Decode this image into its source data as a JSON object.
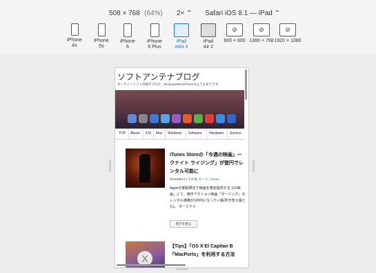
{
  "toolbar": {
    "size": "508 × 768",
    "zoom": "(64%)",
    "scale": "2× ⌃",
    "ua": "Safari iOS 8.1 — iPad ⌃"
  },
  "devices": [
    {
      "l1": "iPhone",
      "l2": "4s"
    },
    {
      "l1": "iPhone",
      "l2": "5s"
    },
    {
      "l1": "iPhone",
      "l2": "6"
    },
    {
      "l1": "iPhone",
      "l2": "6 Plus"
    },
    {
      "l1": "iPad",
      "l2": "mini 3"
    },
    {
      "l1": "iPad",
      "l2": "Air 2"
    },
    {
      "l1": "800 × 600",
      "l2": ""
    },
    {
      "l1": "1366 × 768",
      "l2": ""
    },
    {
      "l1": "1920 × 1080",
      "l2": ""
    }
  ],
  "site": {
    "title": "ソフトアンテナブログ",
    "desc": "オンラインソフトの紹介ブログ。Windows/Mac/iPhoneなんでもありです。",
    "nav": [
      "TOP",
      "About",
      "iOS",
      "Mac",
      "Windows",
      "Software",
      "Hardware",
      "Service"
    ]
  },
  "article1": {
    "title": "iTunes Storeの「今週の映画」ークナイト ライジング」が登円でレンタル可能に",
    "date": "2015/08/12",
    "meta_sep": " | ",
    "cat": "その他, セール, iTunes",
    "body": "Appleが期間限定で映画を格安提供するコの映画」にて、傑作アクション映画「ダージング」のレンタル価格が100円になってい級(吹き替え版とも)。 ダークナイ",
    "readmore": "続きを見る"
  },
  "article2": {
    "title": "【Tips】「OS X El Capitan B「MacPorts」を利用する方法"
  },
  "colors": {
    "accent": "#1a73e8",
    "link": "#2a6bb5"
  }
}
